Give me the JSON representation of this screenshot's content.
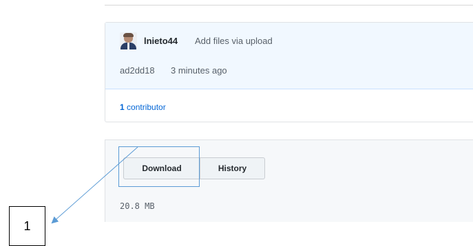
{
  "commit": {
    "author": "lnieto44",
    "message": "Add files via upload",
    "sha": "ad2dd18",
    "time": "3 minutes ago"
  },
  "contributors": {
    "count": "1",
    "label": "contributor"
  },
  "file": {
    "download_label": "Download",
    "history_label": "History",
    "size": "20.8 MB"
  },
  "annotation": {
    "callout_number": "1",
    "highlight_color": "#5b9bd5"
  },
  "colors": {
    "link": "#0366d6",
    "commit_bg": "#f1f8ff",
    "file_bg": "#f6f8fa"
  }
}
